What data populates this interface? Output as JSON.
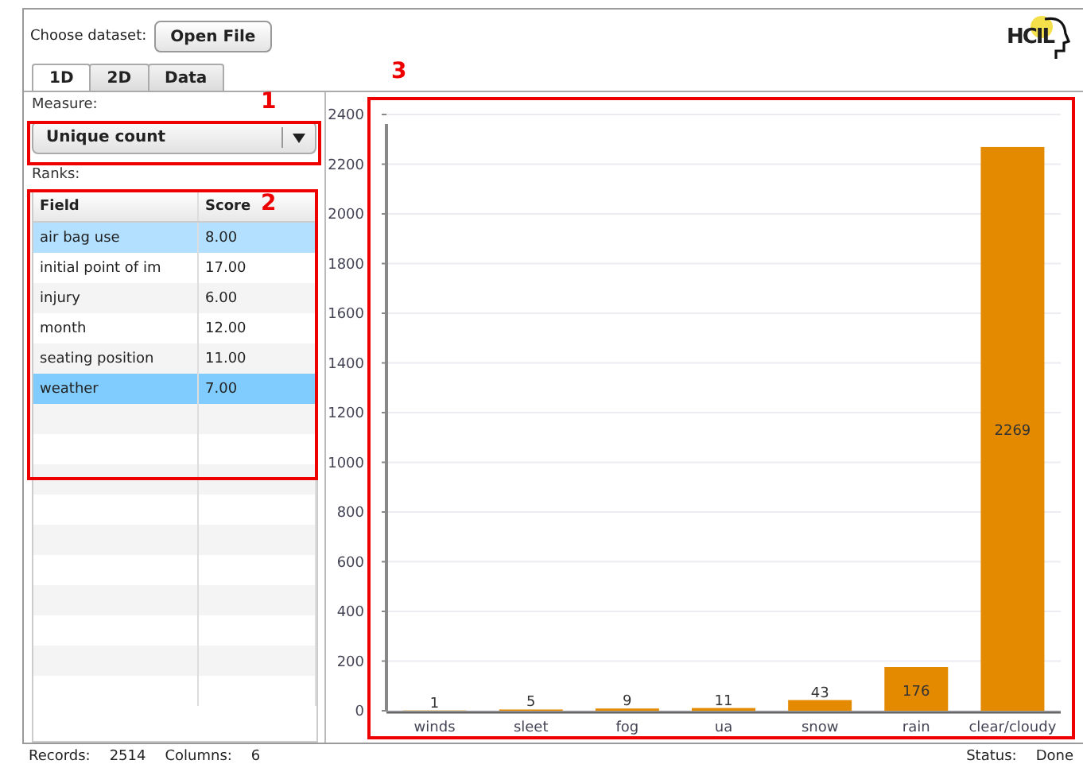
{
  "header": {
    "label": "Choose dataset:",
    "button": "Open File",
    "logo": "HCIL"
  },
  "tabs": [
    {
      "label": "1D",
      "selected": true
    },
    {
      "label": "2D",
      "selected": false
    },
    {
      "label": "Data",
      "selected": false
    }
  ],
  "measure": {
    "label": "Measure:",
    "value": "Unique count"
  },
  "ranks": {
    "label": "Ranks:",
    "columns": [
      "Field",
      "Score"
    ],
    "rows": [
      {
        "field": "air bag use",
        "score": "8.00",
        "selected": false,
        "highlighted": true
      },
      {
        "field": "initial point of im",
        "score": "17.00",
        "selected": false,
        "highlighted": false
      },
      {
        "field": "injury",
        "score": "6.00",
        "selected": false,
        "highlighted": false
      },
      {
        "field": "month",
        "score": "12.00",
        "selected": false,
        "highlighted": false
      },
      {
        "field": "seating position",
        "score": "11.00",
        "selected": false,
        "highlighted": false
      },
      {
        "field": "weather",
        "score": "7.00",
        "selected": true,
        "highlighted": false
      }
    ]
  },
  "chart": {
    "chart_data": {
      "type": "bar",
      "categories": [
        "winds",
        "sleet",
        "fog",
        "ua",
        "snow",
        "rain",
        "clear/cloudy"
      ],
      "series": [
        {
          "color": "#e38a00",
          "values": [
            1,
            5,
            9,
            11,
            43,
            176,
            2269
          ]
        }
      ],
      "ylim": [
        0,
        2400
      ],
      "grid": true,
      "yticks": [
        0,
        200,
        400,
        600,
        800,
        1000,
        1200,
        1400,
        1600,
        1800,
        2000,
        2200,
        2400
      ],
      "data_labels": true
    }
  },
  "annotations": [
    {
      "label": "1"
    },
    {
      "label": "2"
    },
    {
      "label": "3"
    }
  ],
  "status_bar": {
    "records_label": "Records:",
    "records": "2514",
    "columns_label": "Columns:",
    "columns": "6",
    "status_label": "Status:",
    "status": "Done"
  }
}
